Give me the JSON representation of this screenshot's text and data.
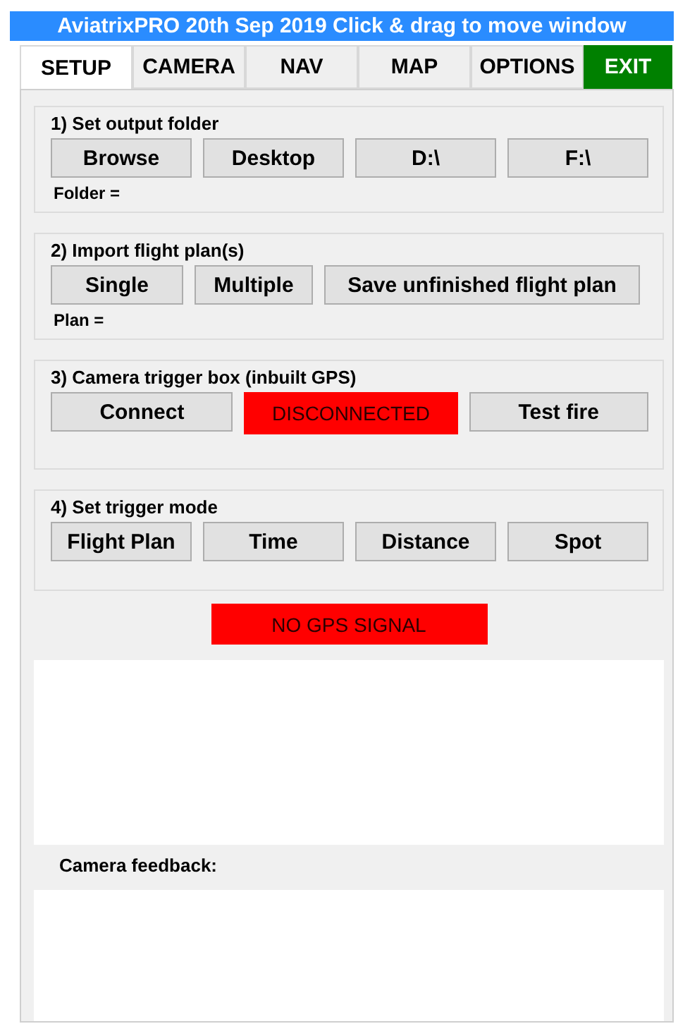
{
  "window": {
    "title": "AviatrixPRO 20th Sep 2019 Click & drag to move window"
  },
  "tabs": [
    {
      "label": "SETUP",
      "selected": true,
      "kind": "tab"
    },
    {
      "label": "CAMERA",
      "selected": false,
      "kind": "tab"
    },
    {
      "label": "NAV",
      "selected": false,
      "kind": "tab"
    },
    {
      "label": "MAP",
      "selected": false,
      "kind": "tab"
    },
    {
      "label": "OPTIONS",
      "selected": false,
      "kind": "tab"
    },
    {
      "label": "EXIT",
      "selected": false,
      "kind": "exit"
    }
  ],
  "sections": [
    {
      "title": "1) Set output folder",
      "controls": [
        {
          "kind": "button",
          "label": "Browse"
        },
        {
          "kind": "button",
          "label": "Desktop"
        },
        {
          "kind": "button",
          "label": "D:\\"
        },
        {
          "kind": "button",
          "label": "F:\\"
        }
      ],
      "note": "Folder ="
    },
    {
      "title": "2) Import flight plan(s)",
      "controls": [
        {
          "kind": "button",
          "label": "Single"
        },
        {
          "kind": "button",
          "label": "Multiple"
        },
        {
          "kind": "button",
          "label": "Save unfinished flight plan"
        }
      ],
      "note": "Plan ="
    },
    {
      "title": "3) Camera trigger box (inbuilt GPS)",
      "controls": [
        {
          "kind": "button",
          "label": "Connect"
        },
        {
          "kind": "indicator",
          "label": "DISCONNECTED",
          "color": "#ff0000"
        },
        {
          "kind": "button",
          "label": "Test fire"
        }
      ]
    },
    {
      "title": "4) Set trigger mode",
      "controls": [
        {
          "kind": "button",
          "label": "Flight Plan"
        },
        {
          "kind": "button",
          "label": "Time"
        },
        {
          "kind": "button",
          "label": "Distance"
        },
        {
          "kind": "button",
          "label": "Spot"
        }
      ]
    }
  ],
  "gps_status": {
    "label": "NO GPS SIGNAL",
    "color": "#ff0000"
  },
  "feedback": {
    "label": "Camera feedback:"
  }
}
